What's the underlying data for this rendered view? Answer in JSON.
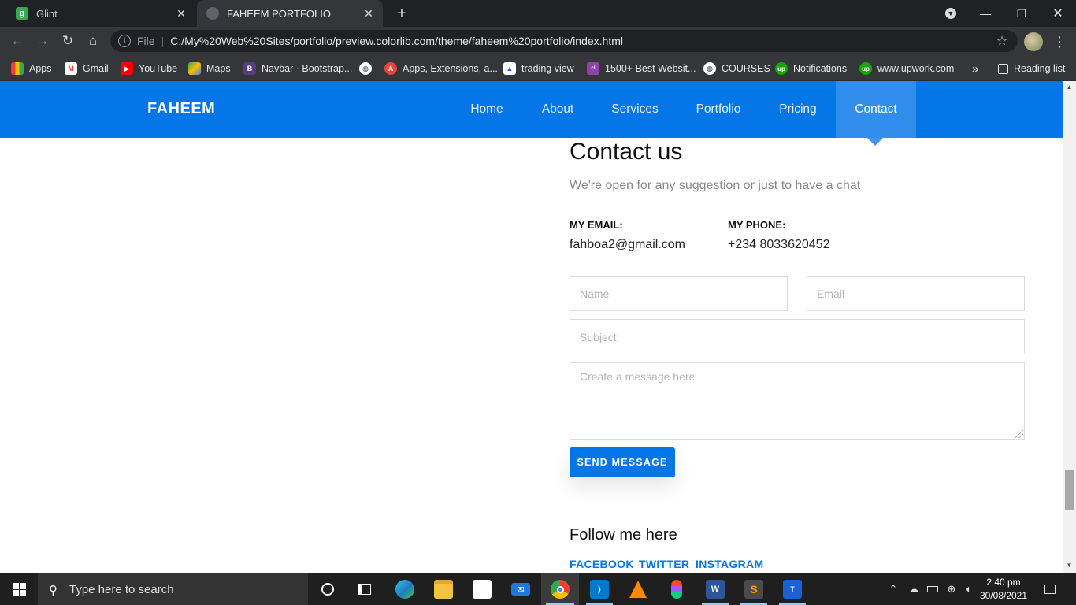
{
  "browser": {
    "tabs": [
      {
        "title": "Glint",
        "favicon": "glint-icon",
        "color": "#34a853"
      },
      {
        "title": "FAHEEM PORTFOLIO",
        "favicon": "globe-icon",
        "active": true
      }
    ],
    "address": {
      "scheme": "File",
      "url": "C:/My%20Web%20Sites/portfolio/preview.colorlib.com/theme/faheem%20portfolio/index.html"
    },
    "bookmarks": [
      {
        "label": "Apps",
        "icon": "apps-grid-icon"
      },
      {
        "label": "Gmail",
        "icon": "gmail-icon"
      },
      {
        "label": "YouTube",
        "icon": "youtube-icon"
      },
      {
        "label": "Maps",
        "icon": "maps-icon"
      },
      {
        "label": "Navbar · Bootstrap...",
        "icon": "bootstrap-icon"
      },
      {
        "label": "",
        "icon": "globe-icon"
      },
      {
        "label": "Apps, Extensions, a...",
        "icon": "extensions-icon"
      },
      {
        "label": "trading view",
        "icon": "tradingview-icon"
      },
      {
        "label": "1500+ Best Websit...",
        "icon": "colorlib-icon"
      },
      {
        "label": "COURSES",
        "icon": "globe-icon"
      },
      {
        "label": "Notifications",
        "icon": "upwork-icon"
      },
      {
        "label": "www.upwork.com",
        "icon": "upwork-icon"
      }
    ],
    "bookmarks_overflow": "»",
    "reading_list": "Reading list"
  },
  "site": {
    "brand": "FAHEEM",
    "nav": [
      "Home",
      "About",
      "Services",
      "Portfolio",
      "Pricing",
      "Contact"
    ],
    "active_nav": "Contact",
    "accent": "#0576e8",
    "contact": {
      "title": "Contact us",
      "subtitle": "We're open for any suggestion or just to have a chat",
      "email_label": "MY EMAIL:",
      "email": "fahboa2@gmail.com",
      "phone_label": "MY PHONE:",
      "phone": "+234 8033620452",
      "form": {
        "name_placeholder": "Name",
        "email_placeholder": "Email",
        "subject_placeholder": "Subject",
        "message_placeholder": "Create a message here",
        "submit": "SEND MESSAGE"
      }
    },
    "follow": {
      "title": "Follow me here",
      "links": [
        "FACEBOOK",
        "TWITTER",
        "INSTAGRAM"
      ]
    }
  },
  "taskbar": {
    "search_placeholder": "Type here to search",
    "apps": [
      "cortana-icon",
      "task-view-icon",
      "edge-icon",
      "file-explorer-icon",
      "store-icon",
      "mail-icon",
      "chrome-icon",
      "vscode-icon",
      "vlc-icon",
      "figma-icon",
      "word-icon",
      "sublime-icon",
      "typora-icon"
    ],
    "clock": {
      "time": "2:40 pm",
      "date": "30/08/2021"
    }
  }
}
